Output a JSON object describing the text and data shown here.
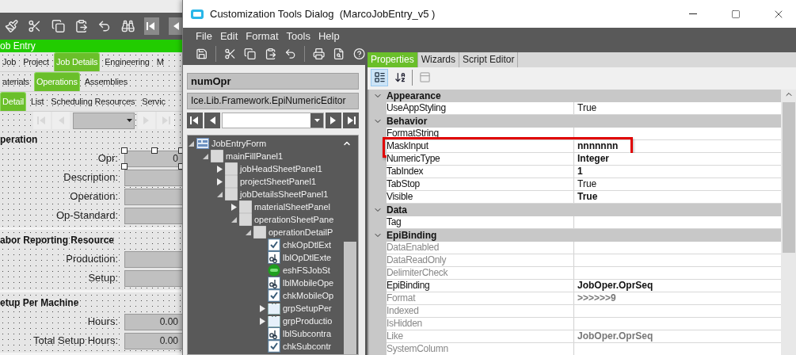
{
  "background_window": {
    "title": "ob Entry",
    "tab_rows": [
      [
        {
          "label": "Job",
          "selected": false
        },
        {
          "label": "Project",
          "selected": false
        },
        {
          "label": "Job Details",
          "selected": true
        },
        {
          "label": "Engineering",
          "selected": false
        },
        {
          "label": "M",
          "selected": false
        }
      ],
      [
        {
          "label": "aterials",
          "selected": false
        },
        {
          "label": "Operations",
          "selected": true
        },
        {
          "label": "Assemblies",
          "selected": false
        }
      ],
      [
        {
          "label": "Detail",
          "selected": true
        },
        {
          "label": "List",
          "selected": false
        },
        {
          "label": "Scheduling Resources",
          "selected": false
        },
        {
          "label": "Servic",
          "selected": false
        }
      ]
    ],
    "sections": [
      {
        "heading": "peration",
        "fields": [
          {
            "label": "Opr:",
            "value": "0",
            "selected": true
          },
          {
            "label": "Description:",
            "selected": false
          },
          {
            "label": "Operation:",
            "selected": false
          },
          {
            "label": "Op-Standard:",
            "selected": false
          }
        ]
      },
      {
        "heading": "abor Reporting Resource",
        "fields": [
          {
            "label": "Production:",
            "selected": false
          },
          {
            "label": "Setup:",
            "selected": false
          }
        ]
      },
      {
        "heading": "etup Per Machine",
        "fields": [
          {
            "label": "Hours:",
            "value": "0.00",
            "selected": false
          },
          {
            "label": "Total Setup Hours:",
            "value": "0.00",
            "selected": false
          }
        ]
      }
    ]
  },
  "dialog": {
    "title": "Customization Tools Dialog  (MarcoJobEntry_v5 )",
    "menu": [
      "File",
      "Edit",
      "Format",
      "Tools",
      "Help"
    ],
    "control_name": "numOpr",
    "control_type": "Ice.Lib.Framework.EpiNumericEditor",
    "tree": [
      {
        "name": "JobEntryForm",
        "kind": "form",
        "expanded": true,
        "children": [
          {
            "name": "mainFillPanel1",
            "kind": "panel",
            "expanded": true,
            "children": [
              {
                "name": "jobHeadSheetPanel1",
                "kind": "panel",
                "expanded": false
              },
              {
                "name": "projectSheetPanel1",
                "kind": "panel",
                "expanded": false
              },
              {
                "name": "jobDetailsSheetPanel1",
                "kind": "panel",
                "expanded": true,
                "children": [
                  {
                    "name": "materialSheetPanel",
                    "kind": "panel",
                    "expanded": false
                  },
                  {
                    "name": "operationSheetPane",
                    "kind": "panel",
                    "expanded": true,
                    "children": [
                      {
                        "name": "operationDetailP",
                        "kind": "panel",
                        "expanded": true,
                        "children": [
                          {
                            "name": "chkOpDtlExt",
                            "kind": "checkbox"
                          },
                          {
                            "name": "lblOpDtlExte",
                            "kind": "label"
                          },
                          {
                            "name": "eshFSJobSt",
                            "kind": "status"
                          },
                          {
                            "name": "lblMobileOpe",
                            "kind": "label"
                          },
                          {
                            "name": "chkMobileOp",
                            "kind": "checkbox"
                          },
                          {
                            "name": "grpSetupPer",
                            "kind": "group",
                            "expanded": false
                          },
                          {
                            "name": "grpProductio",
                            "kind": "group",
                            "expanded": false
                          },
                          {
                            "name": "lblSubcontra",
                            "kind": "label"
                          },
                          {
                            "name": "chkSubcontr",
                            "kind": "checkbox"
                          }
                        ]
                      }
                    ]
                  }
                ]
              }
            ]
          }
        ]
      }
    ],
    "tabs": [
      {
        "label": "Properties",
        "selected": true
      },
      {
        "label": "Wizards",
        "selected": false
      },
      {
        "label": "Script Editor",
        "selected": false
      }
    ],
    "properties": [
      {
        "kind": "category",
        "name": "Appearance",
        "expanded": true
      },
      {
        "kind": "property",
        "name": "UseAppStyling",
        "value": "True",
        "bold": false,
        "dimmed": false,
        "highlighted": false
      },
      {
        "kind": "category",
        "name": "Behavior",
        "expanded": true
      },
      {
        "kind": "property",
        "name": "FormatString",
        "dimmed": false,
        "highlighted": false
      },
      {
        "kind": "property",
        "name": "MaskInput",
        "value": "nnnnnnn",
        "bold": true,
        "dimmed": false,
        "highlighted": true
      },
      {
        "kind": "property",
        "name": "NumericType",
        "value": "Integer",
        "bold": true,
        "dimmed": false,
        "highlighted": false
      },
      {
        "kind": "property",
        "name": "TabIndex",
        "value": "1",
        "bold": true,
        "dimmed": false,
        "highlighted": false
      },
      {
        "kind": "property",
        "name": "TabStop",
        "value": "True",
        "bold": false,
        "dimmed": false,
        "highlighted": false
      },
      {
        "kind": "property",
        "name": "Visible",
        "value": "True",
        "bold": true,
        "dimmed": false,
        "highlighted": false
      },
      {
        "kind": "category",
        "name": "Data",
        "expanded": true
      },
      {
        "kind": "property",
        "name": "Tag",
        "dimmed": false,
        "highlighted": false
      },
      {
        "kind": "category",
        "name": "EpiBinding",
        "expanded": true
      },
      {
        "kind": "property",
        "name": "DataEnabled",
        "dimmed": true,
        "highlighted": false
      },
      {
        "kind": "property",
        "name": "DataReadOnly",
        "dimmed": true,
        "highlighted": false
      },
      {
        "kind": "property",
        "name": "DelimiterCheck",
        "dimmed": true,
        "highlighted": false
      },
      {
        "kind": "property",
        "name": "EpiBinding",
        "value": "JobOper.OprSeq",
        "bold": true,
        "dimmed": false,
        "highlighted": false
      },
      {
        "kind": "property",
        "name": "Format",
        "value": ">>>>>>9",
        "bold": true,
        "dimmed": true,
        "highlighted": false
      },
      {
        "kind": "property",
        "name": "Indexed",
        "dimmed": true,
        "highlighted": false
      },
      {
        "kind": "property",
        "name": "IsHidden",
        "dimmed": true,
        "highlighted": false
      },
      {
        "kind": "property",
        "name": "Like",
        "value": "JobOper.OprSeq",
        "bold": true,
        "dimmed": true,
        "highlighted": false
      },
      {
        "kind": "property",
        "name": "SystemColumn",
        "dimmed": true,
        "highlighted": false
      }
    ]
  }
}
